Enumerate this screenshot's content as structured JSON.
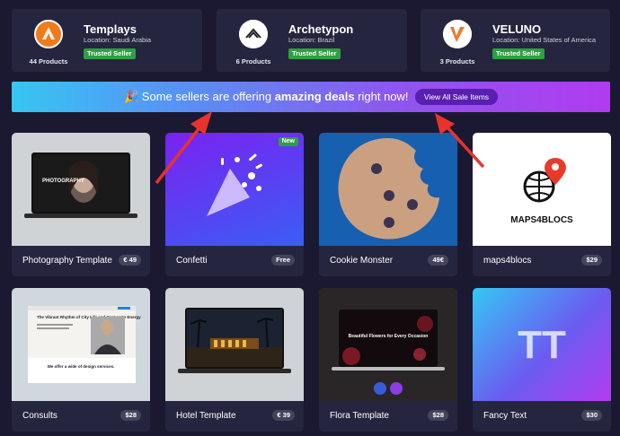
{
  "sellers": [
    {
      "name": "Templays",
      "location": "Location: Saudi Arabia",
      "products": "44 Products",
      "badge": "Trusted Seller",
      "icon": "flame-logo-icon"
    },
    {
      "name": "Archetypon",
      "location": "Location: Brazil",
      "products": "6 Products",
      "badge": "Trusted Seller",
      "icon": "mountain-logo-icon"
    },
    {
      "name": "VELUNO",
      "location": "Location: United States of America",
      "products": "3 Products",
      "badge": "Trusted Seller",
      "icon": "v-logo-icon"
    }
  ],
  "banner": {
    "emoji": "🎉",
    "text_before": " Some sellers are offering ",
    "text_bold": "amazing deals",
    "text_after": " right now!",
    "button": "View All Sale Items"
  },
  "products": [
    {
      "title": "Photography Template",
      "price": "€ 49"
    },
    {
      "title": "Confetti",
      "price": "Free",
      "badge": "New"
    },
    {
      "title": "Cookie Monster",
      "price": "49€"
    },
    {
      "title": "maps4blocs",
      "price": "$29",
      "logo_text": "MAPS4BLOCS"
    },
    {
      "title": "Consults",
      "price": "$28"
    },
    {
      "title": "Hotel Template",
      "price": "€ 39"
    },
    {
      "title": "Flora Template",
      "price": "$28"
    },
    {
      "title": "Fancy Text",
      "price": "$30"
    }
  ],
  "thumb_text": {
    "photography": "PHOTOGRAPHY",
    "consults_heading": "The Vibrant Rhythm of City Life and Corporate Energy",
    "consults_sub": "We offer a wide of design services.",
    "flora_heading": "Beautiful Flowers for Every Occasion",
    "fancy": "TT"
  },
  "colors": {
    "background": "#1b1932",
    "card": "#26253f",
    "trusted_badge": "#2f9e45",
    "banner_start": "#36c6f2",
    "banner_end": "#b03cf0",
    "arrow": "#e8322e"
  }
}
